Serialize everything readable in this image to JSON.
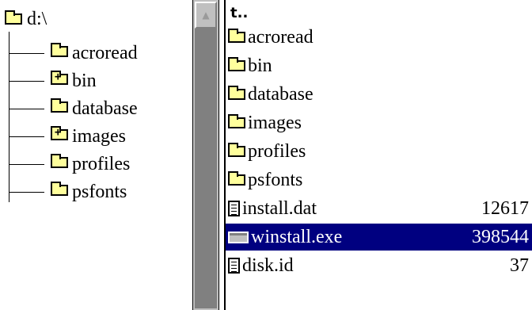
{
  "tree": {
    "root_label": "d:\\",
    "items": [
      {
        "label": "acroread",
        "expandable": false
      },
      {
        "label": "bin",
        "expandable": true
      },
      {
        "label": "database",
        "expandable": false
      },
      {
        "label": "images",
        "expandable": true
      },
      {
        "label": "profiles",
        "expandable": false
      },
      {
        "label": "psfonts",
        "expandable": false
      }
    ]
  },
  "scrollbar": {
    "up_arrow_icon": "triangle-up-icon"
  },
  "file_list": {
    "up_label": "t..",
    "folders": [
      "acroread",
      "bin",
      "database",
      "images",
      "profiles",
      "psfonts"
    ],
    "files": [
      {
        "name": "install.dat",
        "size": "12617",
        "icon": "document-icon",
        "selected": false
      },
      {
        "name": "winstall.exe",
        "size": "398544",
        "icon": "executable-icon",
        "selected": true
      },
      {
        "name": "disk.id",
        "size": "37",
        "icon": "document-icon",
        "selected": false
      }
    ]
  },
  "colors": {
    "folder_fill": "#ffff9c",
    "selection_bg": "#000080",
    "scrollbar_face": "#c0c0c0",
    "scrollbar_track": "#808080"
  }
}
